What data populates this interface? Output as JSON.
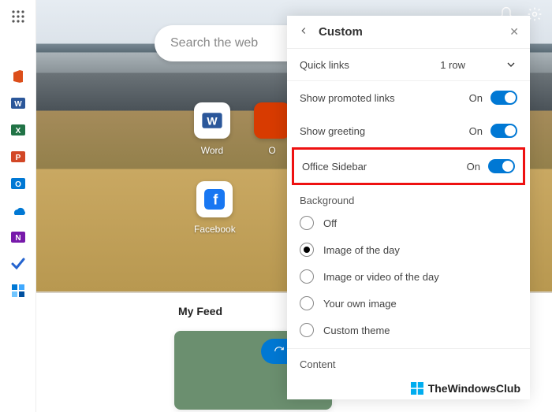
{
  "search": {
    "placeholder": "Search the web"
  },
  "sidebar": {
    "apps": [
      {
        "name": "office-icon"
      },
      {
        "name": "word-icon"
      },
      {
        "name": "excel-icon"
      },
      {
        "name": "powerpoint-icon"
      },
      {
        "name": "outlook-icon"
      },
      {
        "name": "onedrive-icon"
      },
      {
        "name": "onenote-icon"
      },
      {
        "name": "todo-icon"
      },
      {
        "name": "more-apps-icon"
      }
    ]
  },
  "tiles": [
    {
      "label": "Word"
    },
    {
      "label": "O"
    },
    {
      "label": "Facebook"
    }
  ],
  "feed": {
    "title": "My Feed",
    "refresh": "Refres"
  },
  "panel": {
    "title": "Custom",
    "quick_links": {
      "label": "Quick links",
      "value": "1 row"
    },
    "promoted": {
      "label": "Show promoted links",
      "state": "On"
    },
    "greeting": {
      "label": "Show greeting",
      "state": "On"
    },
    "office": {
      "label": "Office Sidebar",
      "state": "On"
    },
    "background": {
      "section": "Background",
      "options": [
        "Off",
        "Image of the day",
        "Image or video of the day",
        "Your own image",
        "Custom theme"
      ],
      "selected": "Image of the day"
    },
    "content_section": "Content"
  },
  "watermark": "TheWindowsClub"
}
